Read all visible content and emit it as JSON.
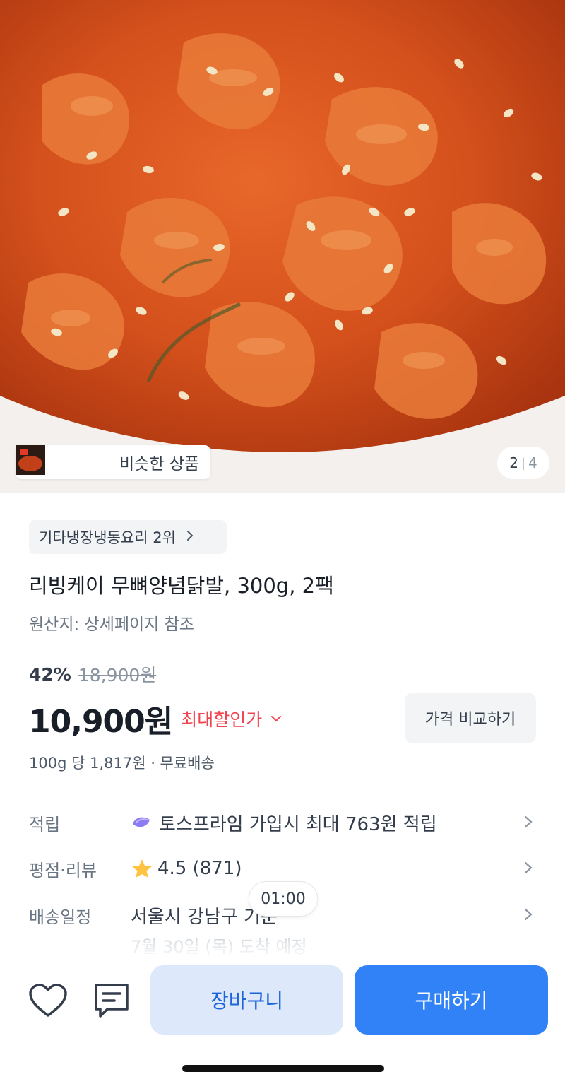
{
  "hero": {
    "similar_label": "비슷한 상품",
    "page_current": "2",
    "page_separator": "|",
    "page_total": "4",
    "icon": "food-photo"
  },
  "product": {
    "rank_label": "기타냉장냉동요리 2위",
    "title": "리빙케이 무뼈양념닭발, 300g, 2팩",
    "origin": "원산지: 상세페이지 참조",
    "discount_rate": "42%",
    "original_price": "18,900원",
    "price": "10,900원",
    "max_discount_label": "최대할인가",
    "compare_button": "가격 비교하기",
    "unit_price": "100g 당 1,817원 · 무료배송"
  },
  "info": {
    "points_label": "적립",
    "points_value": "토스프라임 가입시 최대 763원 적립",
    "rating_label": "평점·리뷰",
    "rating_value": "4.5 (871)",
    "delivery_label": "배송일정",
    "delivery_value": "서울시 강남구 기준",
    "delivery_sub": "7월 30일 (목) 도착 예정"
  },
  "timer": "01:00",
  "actions": {
    "cart": "장바구니",
    "buy": "구매하기"
  },
  "colors": {
    "accent": "#3182f6",
    "accent_light": "#dde9fb",
    "discount_red": "#f04452",
    "star": "#ffc342"
  }
}
